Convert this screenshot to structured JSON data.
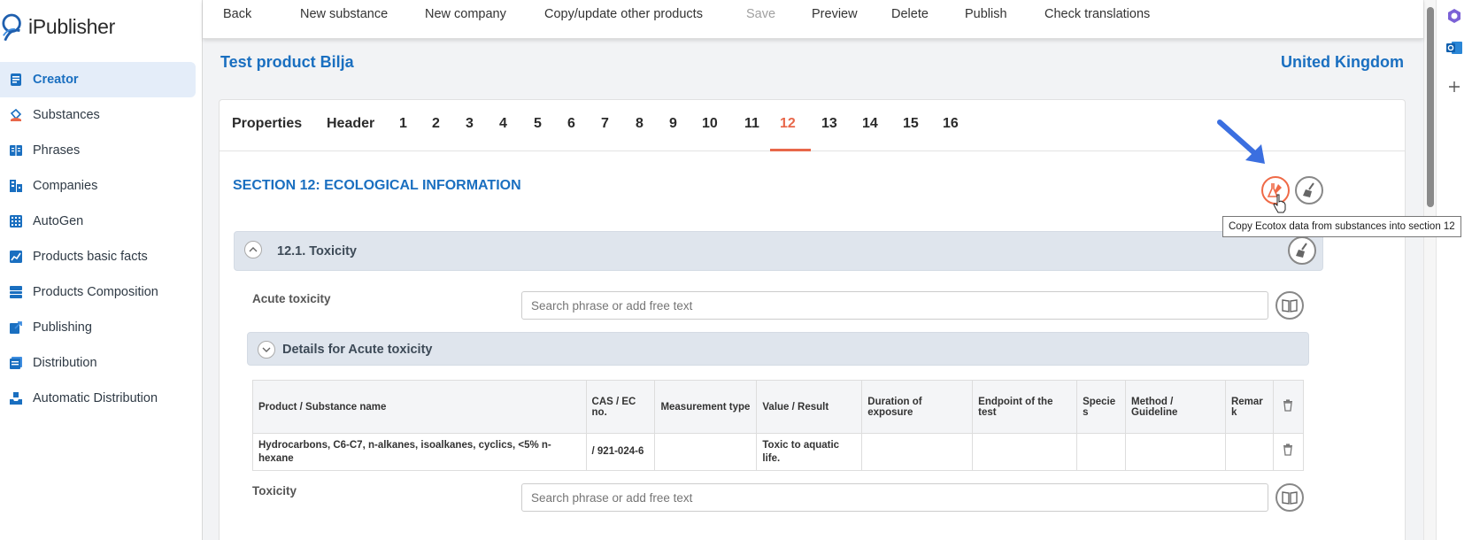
{
  "app": {
    "name": "iPublisher"
  },
  "sidebar": {
    "items": [
      {
        "label": "Creator",
        "icon": "document-icon",
        "active": true
      },
      {
        "label": "Substances",
        "icon": "flask-icon"
      },
      {
        "label": "Phrases",
        "icon": "book-icon"
      },
      {
        "label": "Companies",
        "icon": "building-icon"
      },
      {
        "label": "AutoGen",
        "icon": "grid-icon"
      },
      {
        "label": "Products basic facts",
        "icon": "chart-icon"
      },
      {
        "label": "Products Composition",
        "icon": "layers-icon"
      },
      {
        "label": "Publishing",
        "icon": "publish-icon"
      },
      {
        "label": "Distribution",
        "icon": "distribution-icon"
      },
      {
        "label": "Automatic Distribution",
        "icon": "inbox-icon"
      }
    ]
  },
  "toolbar": {
    "back": "Back",
    "new_substance": "New substance",
    "new_company": "New company",
    "copy_update": "Copy/update other products",
    "save": "Save",
    "preview": "Preview",
    "delete": "Delete",
    "publish": "Publish",
    "check_translations": "Check translations"
  },
  "product": {
    "title": "Test product Bilja",
    "country": "United Kingdom"
  },
  "tabs": [
    "Properties",
    "Header",
    "1",
    "2",
    "3",
    "4",
    "5",
    "6",
    "7",
    "8",
    "9",
    "10",
    "11",
    "12",
    "13",
    "14",
    "15",
    "16"
  ],
  "active_tab": "12",
  "section": {
    "title": "SECTION 12: ECOLOGICAL INFORMATION",
    "tooltip": "Copy Ecotox data from substances into section 12"
  },
  "subsection": {
    "title": "12.1. Toxicity"
  },
  "fields": {
    "acute_toxicity": {
      "label": "Acute toxicity",
      "placeholder": "Search phrase or add free text"
    },
    "toxicity": {
      "label": "Toxicity",
      "placeholder": "Search phrase or add free text"
    }
  },
  "details": {
    "title": "Details for Acute toxicity"
  },
  "table": {
    "headers": [
      "Product / Substance name",
      "CAS / EC no.",
      "Measurement type",
      "Value / Result",
      "Duration of exposure",
      "Endpoint of the test",
      "Specie s",
      "Method / Guideline",
      "Remar k"
    ],
    "rows": [
      [
        "Hydrocarbons, C6-C7, n-alkanes, isoalkanes, cyclics, <5% n-hexane",
        "/ 921-024-6",
        "",
        "Toxic to aquatic life.",
        "",
        "",
        "",
        "",
        ""
      ]
    ]
  },
  "colors": {
    "accent": "#1a6fc0",
    "active_tab": "#e8674a",
    "arrow": "#3b6fe0"
  }
}
